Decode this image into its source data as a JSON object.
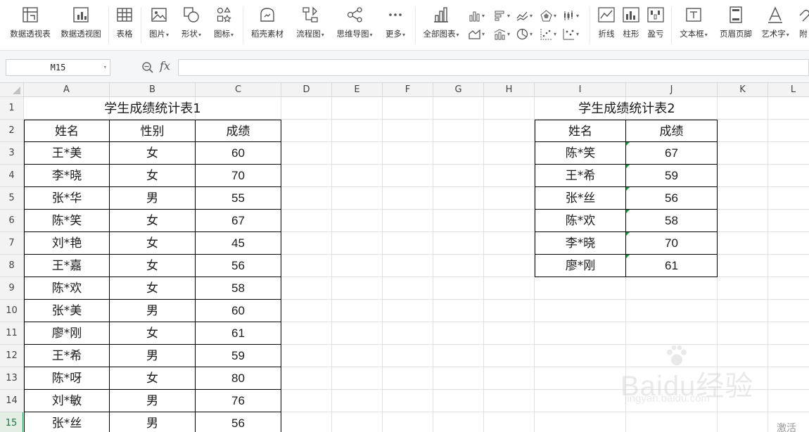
{
  "ribbon": {
    "items": [
      {
        "label": "数据透视表",
        "icon": "pivot-table-icon"
      },
      {
        "label": "数据透视图",
        "icon": "pivot-chart-icon"
      },
      {
        "label": "表格",
        "icon": "table-icon"
      },
      {
        "label": "图片",
        "icon": "picture-icon"
      },
      {
        "label": "形状",
        "icon": "shape-icon"
      },
      {
        "label": "图标",
        "icon": "icons-icon"
      },
      {
        "label": "稻壳素材",
        "icon": "docer-material-icon"
      },
      {
        "label": "流程图",
        "icon": "flowchart-icon"
      },
      {
        "label": "思维导图",
        "icon": "mindmap-icon"
      },
      {
        "label": "更多",
        "icon": "more-icon"
      },
      {
        "label": "全部图表",
        "icon": "all-charts-icon"
      },
      {
        "label": "折线",
        "icon": "sparkline-line-icon"
      },
      {
        "label": "柱形",
        "icon": "sparkline-column-icon"
      },
      {
        "label": "盈亏",
        "icon": "sparkline-winloss-icon"
      },
      {
        "label": "文本框",
        "icon": "textbox-icon"
      },
      {
        "label": "页眉页脚",
        "icon": "header-footer-icon"
      },
      {
        "label": "艺术字",
        "icon": "wordart-icon"
      },
      {
        "label": "附",
        "icon": "attachment-icon"
      }
    ]
  },
  "formula_bar": {
    "cell_ref": "M15",
    "fx_label": "fx",
    "content": ""
  },
  "grid": {
    "columns": [
      "A",
      "B",
      "C",
      "D",
      "E",
      "F",
      "G",
      "H",
      "I",
      "J",
      "K",
      "L"
    ],
    "rows": [
      "1",
      "2",
      "3",
      "4",
      "5",
      "6",
      "7",
      "8",
      "9",
      "10",
      "11",
      "12",
      "13",
      "14",
      "15"
    ],
    "active_row": "15",
    "active_cell": "M15"
  },
  "table1": {
    "title": "学生成绩统计表1",
    "headers": [
      "姓名",
      "性别",
      "成绩"
    ],
    "rows": [
      [
        "王*美",
        "女",
        "60"
      ],
      [
        "李*晓",
        "女",
        "70"
      ],
      [
        "张*华",
        "男",
        "55"
      ],
      [
        "陈*笑",
        "女",
        "67"
      ],
      [
        "刘*艳",
        "女",
        "45"
      ],
      [
        "王*嘉",
        "女",
        "56"
      ],
      [
        "陈*欢",
        "女",
        "58"
      ],
      [
        "张*美",
        "男",
        "60"
      ],
      [
        "廖*刚",
        "女",
        "61"
      ],
      [
        "王*希",
        "男",
        "59"
      ],
      [
        "陈*呀",
        "女",
        "80"
      ],
      [
        "刘*敏",
        "男",
        "76"
      ],
      [
        "张*丝",
        "男",
        "56"
      ]
    ]
  },
  "table2": {
    "title": "学生成绩统计表2",
    "headers": [
      "姓名",
      "成绩"
    ],
    "rows": [
      [
        "陈*笑",
        "67"
      ],
      [
        "王*希",
        "59"
      ],
      [
        "张*丝",
        "56"
      ],
      [
        "陈*欢",
        "58"
      ],
      [
        "李*晓",
        "70"
      ],
      [
        "廖*刚",
        "61"
      ]
    ]
  },
  "watermark": {
    "brand": "Baidu经验",
    "url": "jingyan.baidu.com"
  },
  "activation_text": "激活",
  "colors": {
    "active_row_header": "#e4eee5",
    "active_row_text": "#217346",
    "number_as_text_marker": "#1e8f3a"
  }
}
